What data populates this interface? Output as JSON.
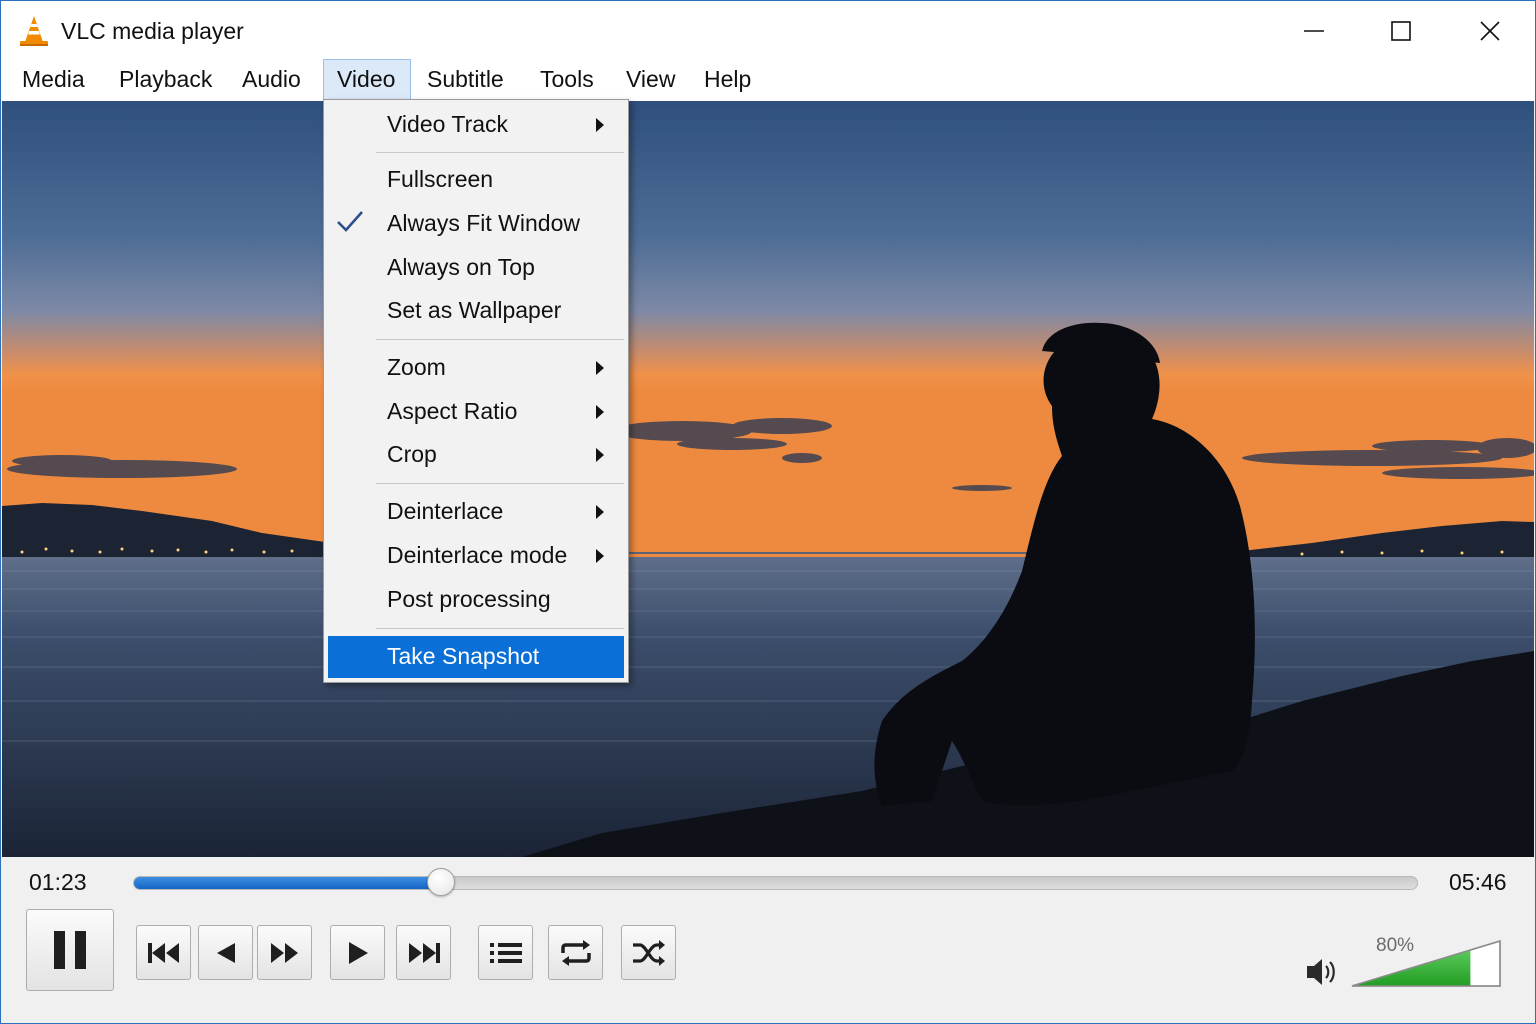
{
  "window": {
    "title": "VLC media player",
    "icons": {
      "app": "vlc-cone-icon",
      "minimize": "minimize-icon",
      "maximize": "maximize-icon",
      "close": "close-icon"
    }
  },
  "menubar": {
    "items": [
      {
        "label": "Media"
      },
      {
        "label": "Playback"
      },
      {
        "label": "Audio"
      },
      {
        "label": "Video",
        "active": true
      },
      {
        "label": "Subtitle"
      },
      {
        "label": "Tools"
      },
      {
        "label": "View"
      },
      {
        "label": "Help"
      }
    ]
  },
  "video_menu": {
    "items": [
      {
        "label": "Video Track",
        "submenu": true
      },
      {
        "label": "Fullscreen"
      },
      {
        "label": "Always Fit Window",
        "checked": true
      },
      {
        "label": "Always on Top"
      },
      {
        "label": "Set as Wallpaper"
      },
      {
        "label": "Zoom",
        "submenu": true
      },
      {
        "label": "Aspect Ratio",
        "submenu": true
      },
      {
        "label": "Crop",
        "submenu": true
      },
      {
        "label": "Deinterlace",
        "submenu": true
      },
      {
        "label": "Deinterlace mode",
        "submenu": true
      },
      {
        "label": "Post processing"
      },
      {
        "label": "Take Snapshot",
        "highlighted": true
      }
    ]
  },
  "playback": {
    "elapsed": "01:23",
    "total": "05:46",
    "progress_fraction": 0.24
  },
  "controls": {
    "buttons": [
      {
        "name": "pause-button",
        "icon": "pause-icon"
      },
      {
        "name": "previous-button",
        "icon": "skip-previous-icon"
      },
      {
        "name": "rewind-button",
        "icon": "rewind-icon"
      },
      {
        "name": "fast-forward-button",
        "icon": "fast-forward-icon"
      },
      {
        "name": "play-button",
        "icon": "play-icon"
      },
      {
        "name": "next-button",
        "icon": "skip-next-icon"
      },
      {
        "name": "playlist-button",
        "icon": "playlist-icon"
      },
      {
        "name": "loop-button",
        "icon": "loop-icon"
      },
      {
        "name": "shuffle-button",
        "icon": "shuffle-icon"
      }
    ]
  },
  "volume": {
    "label": "80%",
    "level_fraction": 0.8,
    "icon": "speaker-icon"
  },
  "colors": {
    "accent": "#0a6fd6",
    "seek_fill": "#1a6fd0",
    "volume_fill": "#2fb52f",
    "menu_active_bg": "#dbe9f8"
  }
}
